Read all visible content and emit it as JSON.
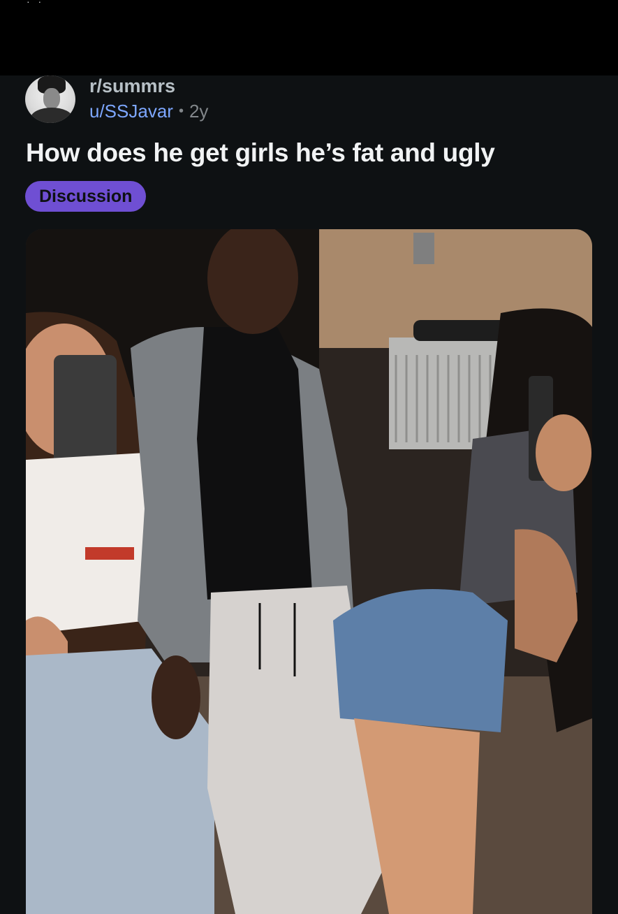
{
  "post": {
    "subreddit": "r/summrs",
    "author": "u/SSJavar",
    "separator": "•",
    "age": "2y",
    "title": "How does he get girls he’s fat and ugly",
    "flair": "Discussion"
  },
  "media": {
    "kind": "photo",
    "description_icon": "image-icon"
  },
  "colors": {
    "background": "#0e1113",
    "topbar": "#000000",
    "flair_bg": "#6f4fd3",
    "username": "#7da7ff",
    "title": "#f1f3f4"
  }
}
